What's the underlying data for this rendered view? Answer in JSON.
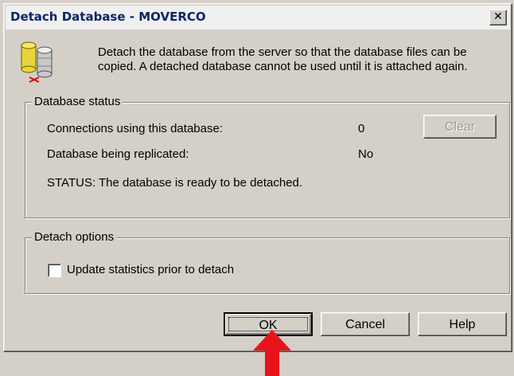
{
  "window": {
    "title": "Detach Database - MOVERCO",
    "close_glyph": "✕"
  },
  "intro": {
    "text": "Detach the database from the server so that the database files can be copied. A detached database cannot be used until it is attached again.",
    "icon": "database-detach-icon"
  },
  "status_group": {
    "legend": "Database status",
    "connections_label": "Connections using this database:",
    "connections_value": "0",
    "replicated_label": "Database being replicated:",
    "replicated_value": "No",
    "status_text": "STATUS:  The database is ready to be detached.",
    "clear_button": "Clear"
  },
  "options_group": {
    "legend": "Detach options",
    "update_stats_label": "Update statistics prior to detach",
    "update_stats_checked": false
  },
  "buttons": {
    "ok": "OK",
    "cancel": "Cancel",
    "help": "Help"
  },
  "annotation": {
    "arrow_color": "#e8141b"
  }
}
